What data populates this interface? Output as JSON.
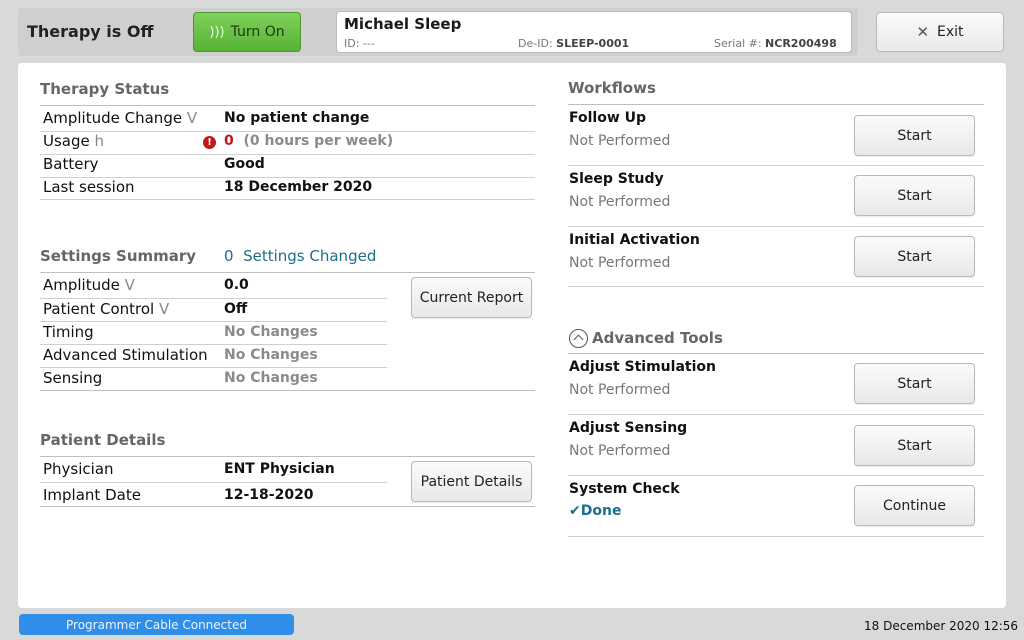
{
  "header": {
    "therapy_status": "Therapy is Off",
    "turn_on_label": "Turn On",
    "patient": {
      "name": "Michael Sleep",
      "id_label": "ID:",
      "id_value": "---",
      "deid_label": "De-ID:",
      "deid_value": "SLEEP-0001",
      "serial_label": "Serial #:",
      "serial_value": "NCR200498"
    },
    "exit_label": "Exit"
  },
  "therapy_status": {
    "title": "Therapy Status",
    "rows": [
      {
        "label": "Amplitude Change",
        "unit": "V",
        "value": "No patient change"
      },
      {
        "label": "Usage",
        "unit": "h",
        "value": "0",
        "value_extra": "(0 hours per week)"
      },
      {
        "label": "Battery",
        "unit": "",
        "value": "Good"
      },
      {
        "label": "Last session",
        "unit": "",
        "value": "18 December 2020"
      }
    ]
  },
  "settings_summary": {
    "title": "Settings Summary",
    "changed_count": "0",
    "changed_label": "Settings Changed",
    "current_report_label": "Current Report",
    "rows": [
      {
        "label": "Amplitude",
        "unit": "V",
        "value": "0.0"
      },
      {
        "label": "Patient Control",
        "unit": "V",
        "value": "Off"
      },
      {
        "label": "Timing",
        "unit": "",
        "value": "No Changes"
      },
      {
        "label": "Advanced Stimulation",
        "unit": "",
        "value": "No Changes"
      },
      {
        "label": "Sensing",
        "unit": "",
        "value": "No Changes"
      }
    ]
  },
  "patient_details": {
    "title": "Patient Details",
    "button_label": "Patient Details",
    "rows": [
      {
        "label": "Physician",
        "value": "ENT Physician"
      },
      {
        "label": "Implant Date",
        "value": "12-18-2020"
      }
    ]
  },
  "workflows": {
    "title": "Workflows",
    "items": [
      {
        "title": "Follow Up",
        "status": "Not Performed",
        "button": "Start"
      },
      {
        "title": "Sleep Study",
        "status": "Not Performed",
        "button": "Start"
      },
      {
        "title": "Initial Activation",
        "status": "Not Performed",
        "button": "Start"
      }
    ]
  },
  "advanced_tools": {
    "title": "Advanced Tools",
    "items": [
      {
        "title": "Adjust Stimulation",
        "status": "Not Performed",
        "button": "Start"
      },
      {
        "title": "Adjust Sensing",
        "status": "Not Performed",
        "button": "Start"
      },
      {
        "title": "System Check",
        "status": "Done",
        "button": "Continue"
      }
    ]
  },
  "footer": {
    "connection_status": "Programmer Cable Connected",
    "datetime": "18 December 2020 12:56"
  },
  "colors": {
    "accent_green": "#57b236",
    "alert_red": "#c21818",
    "link_teal": "#1c6e8c",
    "status_blue": "#2f8fe8"
  }
}
